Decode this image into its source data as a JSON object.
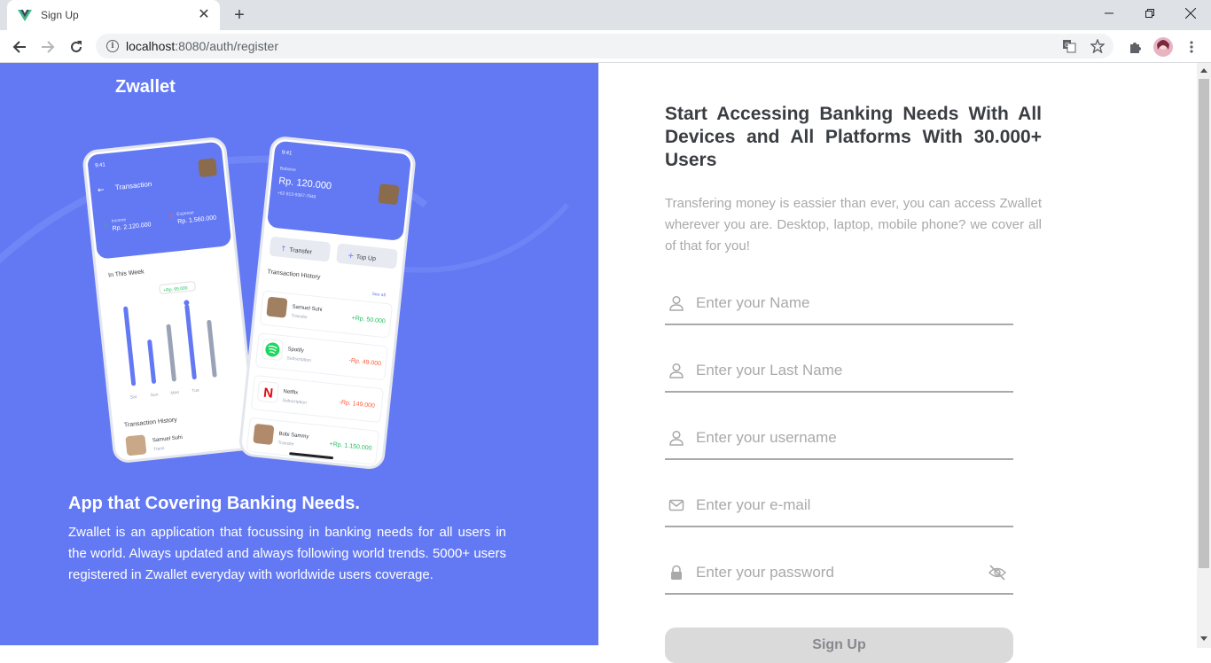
{
  "browser": {
    "tab_title": "Sign Up",
    "url_host": "localhost",
    "url_rest": ":8080/auth/register"
  },
  "sidebar": {
    "brand": "Zwallet",
    "heading": "App that Covering Banking Needs.",
    "description": "Zwallet is an application that focussing in banking needs for all users in the world. Always updated and always following world trends. 5000+ users registered in Zwallet everyday with worldwide users coverage."
  },
  "phone_left": {
    "time": "9:41",
    "title": "Transaction",
    "income_label": "Income",
    "income": "Rp. 2.120.000",
    "expense_label": "Expense",
    "expense": "Rp. 1.560.000",
    "week_label": "In This Week",
    "bar_tooltip": "+Rp. 65.000",
    "days": [
      "Sat",
      "Sun",
      "Mon",
      "Tue"
    ],
    "history_label": "Transaction History",
    "history_name": "Samuel Suhi",
    "history_type": "Trans"
  },
  "phone_right": {
    "time": "9:41",
    "balance_label": "Balance",
    "balance": "Rp. 120.000",
    "phone": "+62 813-9387-7946",
    "transfer": "Transfer",
    "topup": "Top Up",
    "history_label": "Transaction History",
    "see_all": "See all",
    "items": [
      {
        "name": "Samuel Suhi",
        "type": "Transfer",
        "amount": "+Rp. 50.000"
      },
      {
        "name": "Spotify",
        "type": "Subscription",
        "amount": "-Rp. 49.000"
      },
      {
        "name": "Netflix",
        "type": "Subscription",
        "amount": "-Rp. 149.000"
      },
      {
        "name": "Bobi Sammy",
        "type": "Transfer",
        "amount": "+Rp. 1.150.000"
      }
    ]
  },
  "form": {
    "title": "Start Accessing Banking Needs With All Devices and All Platforms With 30.000+ Users",
    "description": "Transfering money is eassier than ever, you can access Zwallet wherever you are. Desktop, laptop, mobile phone? we cover all of that for you!",
    "name_placeholder": "Enter your Name",
    "lastname_placeholder": "Enter your Last Name",
    "username_placeholder": "Enter your username",
    "email_placeholder": "Enter your e-mail",
    "password_placeholder": "Enter your password",
    "submit": "Sign Up"
  },
  "colors": {
    "primary": "#6379f4",
    "income": "#1ec15f",
    "expense": "#ff5b37"
  }
}
